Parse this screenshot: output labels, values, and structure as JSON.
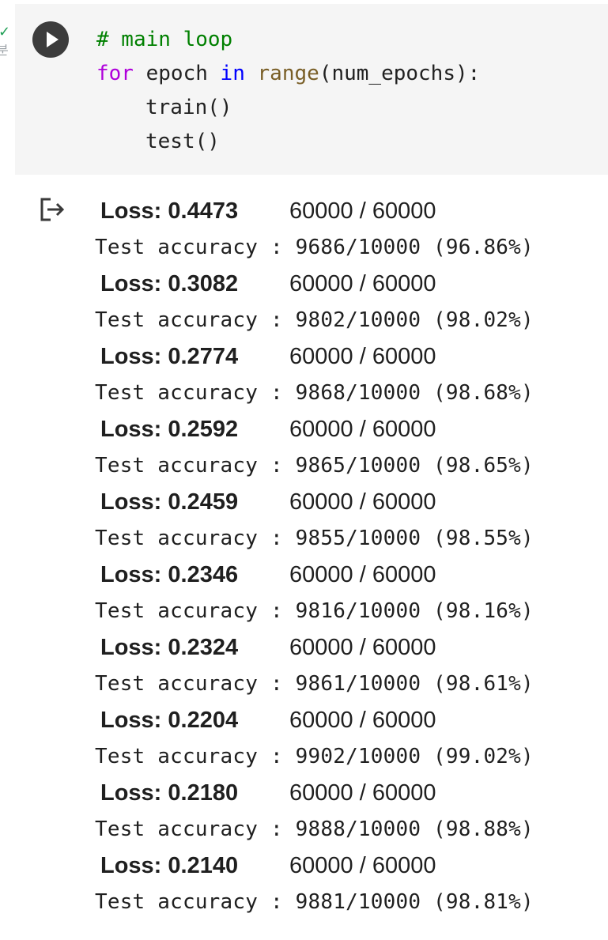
{
  "cell": {
    "status_check": "✓",
    "status_sub": "분",
    "code_lines": [
      {
        "parts": [
          {
            "cls": "comment",
            "text": "# main loop"
          }
        ]
      },
      {
        "parts": [
          {
            "cls": "kw-for",
            "text": "for"
          },
          {
            "cls": "plain",
            "text": " epoch "
          },
          {
            "cls": "kw-in",
            "text": "in"
          },
          {
            "cls": "plain",
            "text": " "
          },
          {
            "cls": "builtin",
            "text": "range"
          },
          {
            "cls": "plain",
            "text": "(num_epochs):"
          }
        ]
      },
      {
        "indent": true,
        "parts": [
          {
            "cls": "plain",
            "text": "train()"
          }
        ]
      },
      {
        "indent": true,
        "parts": [
          {
            "cls": "plain",
            "text": "test()"
          }
        ]
      }
    ]
  },
  "output": {
    "entries": [
      {
        "loss": "Loss: 0.4473",
        "progress": "60000 / 60000",
        "accuracy": "Test accuracy : 9686/10000 (96.86%)"
      },
      {
        "loss": "Loss: 0.3082",
        "progress": "60000 / 60000",
        "accuracy": "Test accuracy : 9802/10000 (98.02%)"
      },
      {
        "loss": "Loss: 0.2774",
        "progress": "60000 / 60000",
        "accuracy": "Test accuracy : 9868/10000 (98.68%)"
      },
      {
        "loss": "Loss: 0.2592",
        "progress": "60000 / 60000",
        "accuracy": "Test accuracy : 9865/10000 (98.65%)"
      },
      {
        "loss": "Loss: 0.2459",
        "progress": "60000 / 60000",
        "accuracy": "Test accuracy : 9855/10000 (98.55%)"
      },
      {
        "loss": "Loss: 0.2346",
        "progress": "60000 / 60000",
        "accuracy": "Test accuracy : 9816/10000 (98.16%)"
      },
      {
        "loss": "Loss: 0.2324",
        "progress": "60000 / 60000",
        "accuracy": "Test accuracy : 9861/10000 (98.61%)"
      },
      {
        "loss": "Loss: 0.2204",
        "progress": "60000 / 60000",
        "accuracy": "Test accuracy : 9902/10000 (99.02%)"
      },
      {
        "loss": "Loss: 0.2180",
        "progress": "60000 / 60000",
        "accuracy": "Test accuracy : 9888/10000 (98.88%)"
      },
      {
        "loss": "Loss: 0.2140",
        "progress": "60000 / 60000",
        "accuracy": "Test accuracy : 9881/10000 (98.81%)"
      }
    ]
  },
  "colors": {
    "cell_background": "#f5f5f5",
    "run_button": "#3c3c3c",
    "comment": "#008000",
    "keyword_for": "#af00db",
    "keyword_in": "#0000ff",
    "builtin": "#795e26",
    "status_check": "#1e9e54"
  },
  "icons": {
    "run": "play-icon",
    "output": "output-redirect-icon"
  }
}
